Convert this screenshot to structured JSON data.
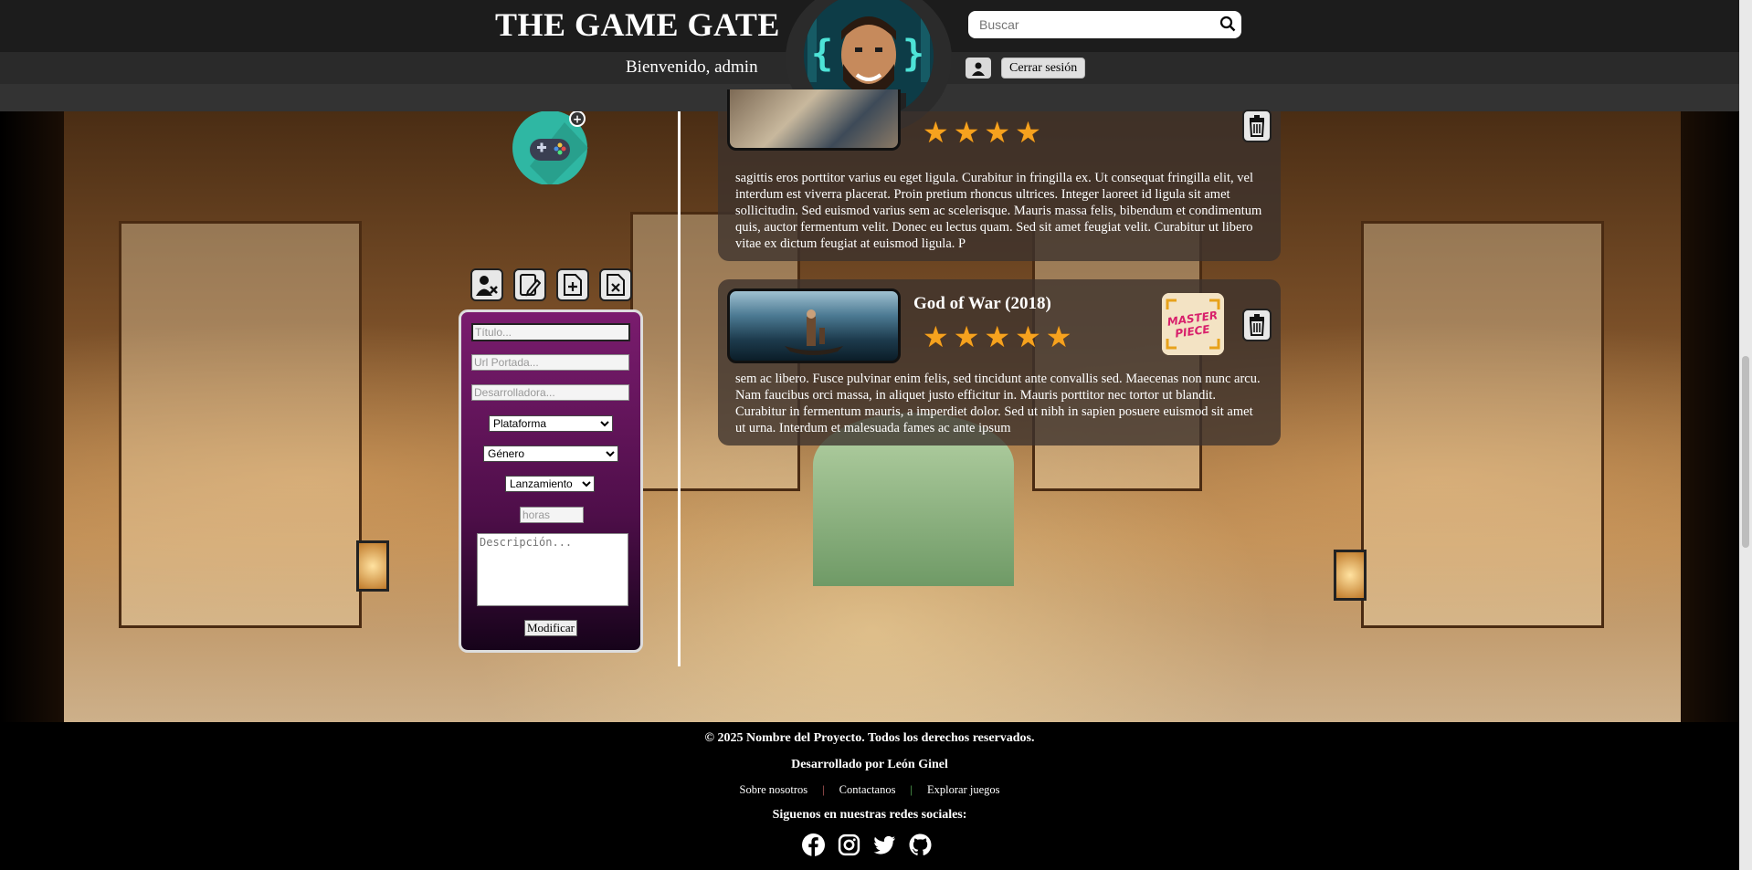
{
  "header": {
    "title": "THE GAME GATE",
    "welcome": "Bienvenido, admin",
    "search_placeholder": "Buscar",
    "logout_label": "Cerrar sesión"
  },
  "form": {
    "title_placeholder": "Título...",
    "cover_placeholder": "Url Portada...",
    "developer_placeholder": "Desarrolladora...",
    "platform_selected": "Plataforma",
    "genre_selected": "Género",
    "release_selected": "Lanzamiento",
    "hours_placeholder": "horas",
    "description_placeholder": "Descripción...",
    "submit_label": "Modificar"
  },
  "reviews": [
    {
      "title": "",
      "rating": 4,
      "body": "sagittis eros porttitor varius eu eget ligula. Curabitur in fringilla ex. Ut consequat fringilla elit, vel interdum est viverra placerat. Proin pretium rhoncus ultrices. Integer laoreet id ligula sit amet sollicitudin. Sed euismod varius sem ac scelerisque. Mauris massa felis, bibendum et condimentum quis, auctor fermentum velit. Donec eu lectus quam. Sed sit amet feugiat velit. Curabitur ut libero vitae ex dictum feugiat at euismod ligula. P"
    },
    {
      "title": "God of War (2018)",
      "rating": 5,
      "badge": "MASTER PIECE",
      "body": "sem ac libero. Fusce pulvinar enim felis, sed tincidunt ante convallis sed. Maecenas non nunc arcu. Nam faucibus orci massa, in aliquet justo efficitur in. Mauris porttitor nec tortor ut blandit. Curabitur in fermentum mauris, a imperdiet dolor. Sed ut nibh in sapien posuere euismod sit amet ut urna. Interdum et malesuada fames ac ante ipsum"
    }
  ],
  "footer": {
    "copyright": "© 2025 Nombre del Proyecto. Todos los derechos reservados.",
    "developed_by": "Desarrollado por León Ginel",
    "links": [
      "Sobre nosotros",
      "Contactanos",
      "Explorar juegos"
    ],
    "social_title": "Siguenos en nuestras redes sociales:"
  },
  "icons": [
    "search-icon",
    "user-icon",
    "add-game-icon",
    "remove-user-icon",
    "edit-icon",
    "add-file-icon",
    "delete-file-icon",
    "trash-icon",
    "star-icon",
    "facebook-icon",
    "instagram-icon",
    "twitter-icon",
    "github-icon"
  ],
  "colors": {
    "star": "#f6a21e",
    "form_top": "#7a1c6e",
    "form_bottom": "#16031a",
    "header": "#1c1c1c"
  }
}
